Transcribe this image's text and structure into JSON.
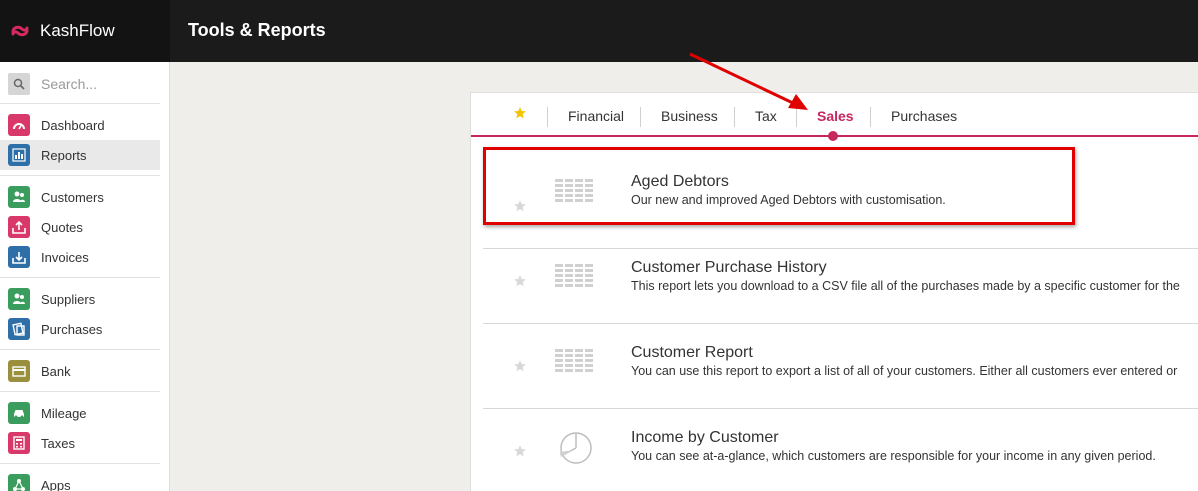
{
  "app": {
    "brand": "KashFlow",
    "page_title": "Tools & Reports"
  },
  "search": {
    "placeholder": "Search..."
  },
  "sidebar": {
    "items": [
      {
        "key": "dashboard",
        "label": "Dashboard",
        "color": "#d8386a"
      },
      {
        "key": "reports",
        "label": "Reports",
        "color": "#2f6fa8",
        "active": true
      },
      {
        "key": "customers",
        "label": "Customers",
        "color": "#3a9d5d"
      },
      {
        "key": "quotes",
        "label": "Quotes",
        "color": "#d8386a"
      },
      {
        "key": "invoices",
        "label": "Invoices",
        "color": "#2f6fa8"
      },
      {
        "key": "suppliers",
        "label": "Suppliers",
        "color": "#3a9d5d"
      },
      {
        "key": "purchases",
        "label": "Purchases",
        "color": "#2f6fa8"
      },
      {
        "key": "bank",
        "label": "Bank",
        "color": "#9a8f3c"
      },
      {
        "key": "mileage",
        "label": "Mileage",
        "color": "#3a9d5d"
      },
      {
        "key": "taxes",
        "label": "Taxes",
        "color": "#d8386a"
      },
      {
        "key": "apps",
        "label": "Apps",
        "color": "#3a9d5d"
      }
    ]
  },
  "tabs": [
    {
      "key": "financial",
      "label": "Financial"
    },
    {
      "key": "business",
      "label": "Business"
    },
    {
      "key": "tax",
      "label": "Tax"
    },
    {
      "key": "sales",
      "label": "Sales",
      "active": true
    },
    {
      "key": "purchases",
      "label": "Purchases"
    }
  ],
  "reports": [
    {
      "title": "Aged Debtors",
      "description": "Our new and improved Aged Debtors with customisation.",
      "icon": "table-icon"
    },
    {
      "title": "Customer Purchase History",
      "description": "This report lets you download to a CSV file all of the purchases made by a specific customer for the",
      "icon": "table-icon"
    },
    {
      "title": "Customer Report",
      "description": "You can use this report to export a list of all of your customers. Either all customers ever entered or",
      "icon": "table-icon"
    },
    {
      "title": "Income by Customer",
      "description": "You can see at-a-glance, which customers are responsible for your income in any given period.",
      "icon": "pie-chart-icon"
    }
  ],
  "colors": {
    "accent": "#c7265f",
    "annotation": "#e00000",
    "favorite_star": "#f5c400"
  }
}
